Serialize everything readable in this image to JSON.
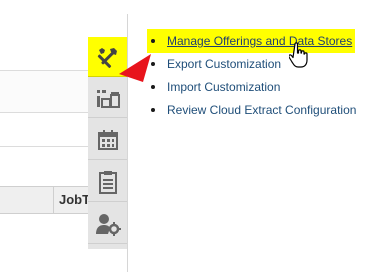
{
  "background_table": {
    "column_header": "JobT"
  },
  "rail": {
    "buttons": [
      {
        "icon": "tools-icon",
        "active": true
      },
      {
        "icon": "data-store-icon",
        "active": false
      },
      {
        "icon": "calendar-icon",
        "active": false
      },
      {
        "icon": "clipboard-icon",
        "active": false
      },
      {
        "icon": "user-settings-icon",
        "active": false
      }
    ],
    "active_color": "#ffff00"
  },
  "menu": {
    "items": [
      {
        "label": "Manage Offerings and Data Stores",
        "highlighted": true
      },
      {
        "label": "Export Customization",
        "highlighted": false
      },
      {
        "label": "Import Customization",
        "highlighted": false
      },
      {
        "label": "Review Cloud Extract Configuration",
        "highlighted": false
      }
    ],
    "link_color": "#1f4e79",
    "highlight_color": "#ffff00"
  },
  "annotations": {
    "arrow_color": "#e8141c"
  }
}
